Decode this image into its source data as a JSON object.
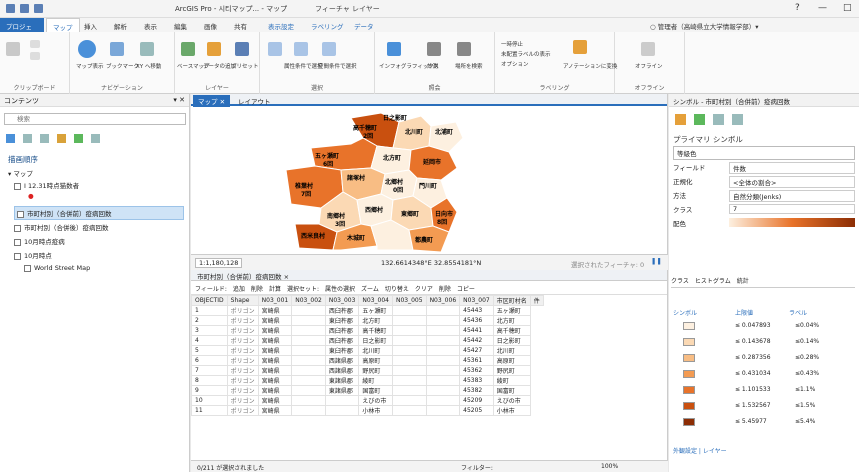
{
  "titlebar": {
    "title": "ArcGIS Pro - 시티マップ... - マップ",
    "context_tab": "フィーチャ レイヤー",
    "win": [
      "?",
      "—",
      "□"
    ]
  },
  "tabs": [
    "プロジェクト",
    "マップ",
    "挿入",
    "解析",
    "表示",
    "編集",
    "画像",
    "共有",
    "表示設定",
    "ラベリング",
    "データ"
  ],
  "user": "○ 管理者（高崎県立大学情報学部）▾",
  "ribbon": {
    "groups": [
      "クリップボード",
      "ナビゲーション",
      "レイヤー",
      "選択",
      "照会",
      "ラベリング",
      "オフライン"
    ],
    "items": [
      "マップ表示",
      "ブックマーク",
      "XY へ移動",
      "ベースマップ",
      "データの追加",
      "プリセット",
      "属性条件で選択",
      "空間条件で選択",
      "インフォグラフィックス",
      "計測",
      "場所を検索",
      "ラベル",
      "一時停止",
      "未配置ラベルの表示",
      "オプション",
      "アノテーションに変換",
      "オフライン"
    ]
  },
  "contents": {
    "title": "コンテンツ",
    "search_placeholder": "検索",
    "order_label": "描画順序",
    "layers": [
      "マップ",
      "Ⅰ 12.31時点猫数者",
      "市町村別（合併前）疫病回数",
      "市町村別（合併後）疫病回数",
      "10月時点疫病",
      "10月時点",
      "World Street Map"
    ]
  },
  "map": {
    "tabs": [
      "マップ",
      "レイアウト"
    ],
    "labels": [
      "日之影町",
      "高千穂町",
      "2回",
      "五ヶ瀬町",
      "6回",
      "北川町",
      "5回",
      "北浦町",
      "諸塚村",
      "北方町",
      "延岡市",
      "椎葉村",
      "北郷村",
      "門川町",
      "西郷村",
      "南郷村",
      "日向市",
      "西米良村",
      "東郷町",
      "木城町",
      "都農町",
      "5回",
      "3回",
      "7回",
      "0回",
      "1回",
      "8回",
      "2回",
      "4回"
    ],
    "scale": "1:1,180,128",
    "coords": "132.6614348°E 32.8554181°N",
    "selected": "選択されたフィーチャ: 0"
  },
  "attr": {
    "tabs": [
      "市町村別（合併前）疫病回数 ×"
    ],
    "toolbar": [
      "フィールド:",
      "追加",
      "削除",
      "計算",
      "選択セット:",
      "属性の選択",
      "ズーム",
      "切り替え",
      "クリア",
      "削除",
      "コピー"
    ],
    "columns": [
      "OBJECTID",
      "Shape",
      "N03_001",
      "N03_002",
      "N03_003",
      "N03_004",
      "N03_005",
      "N03_006",
      "N03_007",
      "市区町村名",
      "件"
    ],
    "rows": [
      [
        "1",
        "ポリゴン",
        "宮崎県",
        "",
        "西臼杵郡",
        "五ヶ瀬町",
        "",
        "",
        "45443",
        "五ヶ瀬町"
      ],
      [
        "2",
        "ポリゴン",
        "宮崎県",
        "",
        "東臼杵郡",
        "北方町",
        "",
        "",
        "45436",
        "北方町"
      ],
      [
        "3",
        "ポリゴン",
        "宮崎県",
        "",
        "西臼杵郡",
        "高千穂町",
        "",
        "",
        "45441",
        "高千穂町"
      ],
      [
        "4",
        "ポリゴン",
        "宮崎県",
        "",
        "西臼杵郡",
        "日之影町",
        "",
        "",
        "45442",
        "日之影町"
      ],
      [
        "5",
        "ポリゴン",
        "宮崎県",
        "",
        "東臼杵郡",
        "北川町",
        "",
        "",
        "45427",
        "北川町"
      ],
      [
        "6",
        "ポリゴン",
        "宮崎県",
        "",
        "西諸県郡",
        "高原町",
        "",
        "",
        "45361",
        "高原町"
      ],
      [
        "7",
        "ポリゴン",
        "宮崎県",
        "",
        "西諸県郡",
        "野尻町",
        "",
        "",
        "45362",
        "野尻町"
      ],
      [
        "8",
        "ポリゴン",
        "宮崎県",
        "",
        "東諸県郡",
        "綾町",
        "",
        "",
        "45383",
        "綾町"
      ],
      [
        "9",
        "ポリゴン",
        "宮崎県",
        "",
        "東諸県郡",
        "国富町",
        "",
        "",
        "45382",
        "国富町"
      ],
      [
        "10",
        "ポリゴン",
        "宮崎県",
        "",
        "",
        "えびの市",
        "",
        "",
        "45209",
        "えびの市"
      ],
      [
        "11",
        "ポリゴン",
        "宮崎県",
        "",
        "",
        "小林市",
        "",
        "",
        "45205",
        "小林市"
      ]
    ],
    "footer": "0/211 が選択されました",
    "filter": "フィルター:",
    "zoom": "100%"
  },
  "symbology": {
    "title": "シンボル - 市町村別（合併前）疫病回数",
    "primary": "プライマリ シンボル",
    "method": "等級色",
    "fields": [
      [
        "フィールド",
        "件数"
      ],
      [
        "正規化",
        "<全体の割合>"
      ],
      [
        "方法",
        "自然分類(Jenks)"
      ],
      [
        "クラス",
        "7"
      ],
      [
        "配色",
        ""
      ]
    ],
    "subtabs": [
      "クラス",
      "ヒストグラム",
      "統計"
    ],
    "headers": [
      "シンボル",
      "上限値",
      "ラベル"
    ],
    "classes": [
      [
        "≤ 0.047893",
        "≤0.04%",
        "#fdf0e0"
      ],
      [
        "≤ 0.143678",
        "≤0.14%",
        "#fbd9b4"
      ],
      [
        "≤ 0.287356",
        "≤0.28%",
        "#f8bd84"
      ],
      [
        "≤ 0.431034",
        "≤0.43%",
        "#f39b52"
      ],
      [
        "≤ 1.101533",
        "≤1.1%",
        "#e8732a"
      ],
      [
        "≤ 1.532567",
        "≤1.5%",
        "#c9500f"
      ],
      [
        "≤ 5.45977",
        "≤5.4%",
        "#8c2d04"
      ]
    ],
    "footer": "外観設定 | レイヤー"
  },
  "colors": {
    "accent": "#2a6ebb"
  }
}
